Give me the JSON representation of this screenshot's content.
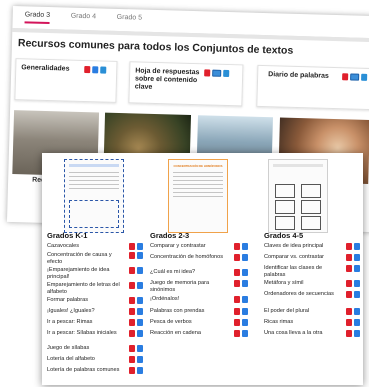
{
  "tabs": [
    "Grado 3",
    "Grado 4",
    "Grado 5"
  ],
  "title": "Recursos comunes para todos los Conjuntos de textos",
  "cards": [
    "Generalidades",
    "Hoja de respuestas sobre el contenido clave",
    "Diario de palabras"
  ],
  "photo_label": "Recic",
  "columns": [
    {
      "heading": "Grados K-1",
      "items": [
        "Cazavocales",
        "Concentración de causa y efecto",
        "¡Emparejamiento de idea principal!",
        "Emparejamiento de letras del alfabeto",
        "Formar palabras",
        "¡Iguales! ¿Iguales?",
        "Ir a pescar: Rimas",
        "Ir a pescar: Sílabas iniciales",
        "Juego de sílabas",
        "Lotería del alfabeto",
        "Lotería de palabras comunes"
      ]
    },
    {
      "heading": "Grados 2-3",
      "items": [
        "Comparar y contrastar",
        "Concentración de homófonos",
        "¿Cuál es mi idea?",
        "Juego de memoria para sinónimos",
        "¡Ordénalos!",
        "Palabras con prendas",
        "Pesca de verbos",
        "Reacción en cadena"
      ]
    },
    {
      "heading": "Grados 4-5",
      "items": [
        "Claves de idea principal",
        "Comparar vs. contrastar",
        "Identificar las clases de palabras",
        "Metáfora y símil",
        "Ordenadores de secuencias",
        "El poder del plural",
        "Ricas rimas",
        "Una cosa lleva a la otra"
      ]
    }
  ],
  "thumbs": [
    "CONCENTRACIÓN DE HOMÓFONOS"
  ],
  "colors": {
    "accent": "#d3145a",
    "pdf": "#e0202c",
    "download": "#2a7de1"
  },
  "icons": [
    "pdf-icon",
    "download-icon",
    "monitor-icon"
  ]
}
